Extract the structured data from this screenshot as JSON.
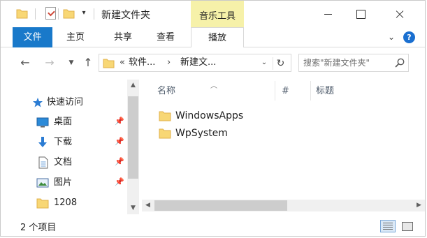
{
  "window": {
    "title": "新建文件夹",
    "context_tab": "音乐工具"
  },
  "ribbon": {
    "tabs": [
      "文件",
      "主页",
      "共享",
      "查看",
      "播放"
    ],
    "collapse_glyph": "⌄",
    "help_glyph": "?"
  },
  "address": {
    "overflow": "«",
    "segments": [
      "软件...",
      "新建文..."
    ],
    "separator": "›"
  },
  "search": {
    "placeholder": "搜索\"新建文件夹\""
  },
  "navigation": {
    "quick_access_label": "快速访问",
    "items": [
      {
        "label": "桌面",
        "icon": "desktop-icon",
        "pinned": true
      },
      {
        "label": "下载",
        "icon": "download-icon",
        "pinned": true
      },
      {
        "label": "文档",
        "icon": "document-icon",
        "pinned": true
      },
      {
        "label": "图片",
        "icon": "picture-icon",
        "pinned": true
      },
      {
        "label": "1208",
        "icon": "folder-icon",
        "pinned": false
      }
    ]
  },
  "columns": {
    "name": "名称",
    "number": "#",
    "title": "标题"
  },
  "files": [
    {
      "name": "WindowsApps",
      "icon": "folder-icon"
    },
    {
      "name": "WpSystem",
      "icon": "folder-icon"
    }
  ],
  "status": {
    "item_count": "2 个项目"
  },
  "colors": {
    "file_tab": "#1979ca",
    "music_tools": "#f6f1a9",
    "folder_yellow": "#f8d775",
    "folder_dark": "#e8b84a",
    "star_blue": "#2b7cd3"
  }
}
